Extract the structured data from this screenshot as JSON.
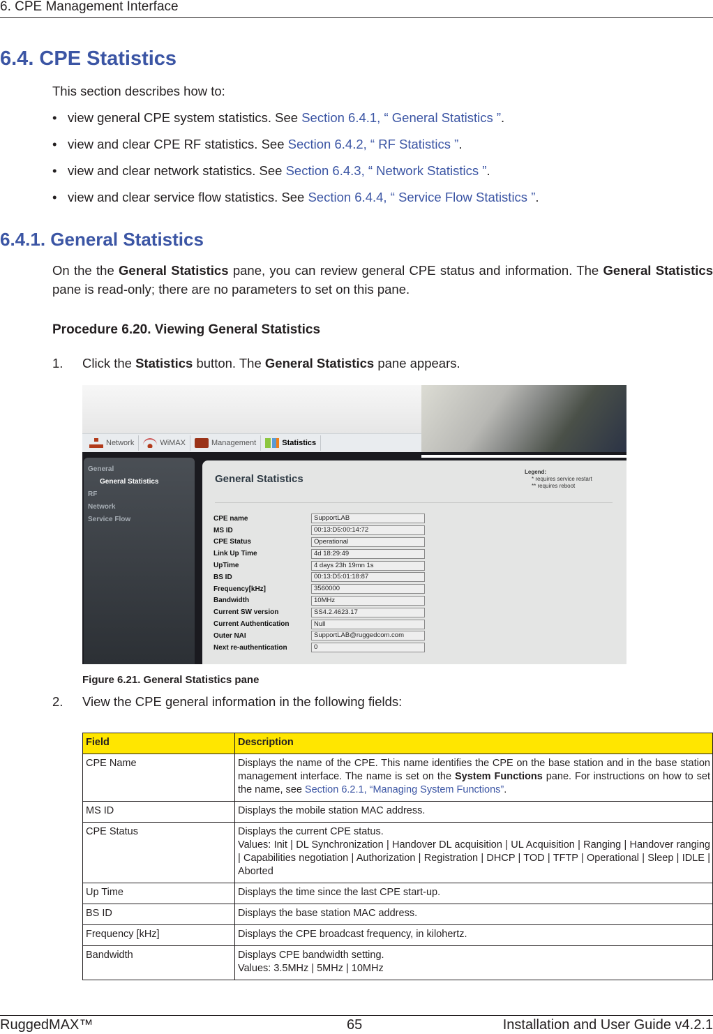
{
  "header": {
    "running_title": "6. CPE Management Interface"
  },
  "section": {
    "title": "6.4. CPE Statistics",
    "intro": "This section describes how to:",
    "bullets": [
      {
        "text": "view general CPE system statistics. See ",
        "link": "Section 6.4.1, “ General Statistics ”",
        "tail": "."
      },
      {
        "text": "view and clear CPE RF statistics. See ",
        "link": "Section 6.4.2, “ RF Statistics ”",
        "tail": "."
      },
      {
        "text": "view and clear network statistics. See ",
        "link": "Section 6.4.3, “ Network Statistics ”",
        "tail": "."
      },
      {
        "text": "view and clear service flow statistics. See ",
        "link": "Section 6.4.4, “ Service Flow Statistics ”",
        "tail": "."
      }
    ]
  },
  "subsection": {
    "title": "6.4.1.  General Statistics",
    "para_1": "On the the ",
    "para_bold_1": "General Statistics",
    "para_2": " pane, you can review general CPE status and information. The ",
    "para_bold_2": "General Statistics",
    "para_3": " pane is read-only; there are no parameters to set on this pane."
  },
  "procedure": {
    "title": "Procedure 6.20. Viewing General Statistics",
    "step1": {
      "num": "1.",
      "t1": "Click the ",
      "b1": "Statistics",
      "t2": " button. The ",
      "b2": "General Statistics",
      "t3": " pane appears."
    },
    "step2": {
      "num": "2.",
      "text": "View the CPE general information in the following fields:"
    }
  },
  "screenshot": {
    "nav": [
      {
        "label": "Network",
        "icon": "network-icon"
      },
      {
        "label": "WiMAX",
        "icon": "wimax-icon"
      },
      {
        "label": "Management",
        "icon": "management-icon"
      },
      {
        "label": "Statistics",
        "icon": "statistics-icon",
        "active": true
      }
    ],
    "sidebar": [
      {
        "label": "General"
      },
      {
        "label": "General Statistics",
        "sub": true
      },
      {
        "label": "RF"
      },
      {
        "label": "Network"
      },
      {
        "label": "Service Flow"
      }
    ],
    "pane_title": "General Statistics",
    "legend": {
      "title": "Legend:",
      "line1": "*  requires service restart",
      "line2": "** requires reboot"
    },
    "fields": [
      {
        "label": "CPE name",
        "value": "SupportLAB"
      },
      {
        "label": "MS ID",
        "value": "00:13:D5:00:14:72"
      },
      {
        "label": "CPE Status",
        "value": "Operational"
      },
      {
        "label": "Link Up Time",
        "value": "4d 18:29:49"
      },
      {
        "label": "UpTime",
        "value": "4 days 23h 19mn 1s"
      },
      {
        "label": "BS ID",
        "value": "00:13:D5:01:18:87"
      },
      {
        "label": "Frequency[kHz]",
        "value": "3560000"
      },
      {
        "label": "Bandwidth",
        "value": "10MHz"
      },
      {
        "label": "Current SW version",
        "value": "SS4.2.4623.17"
      },
      {
        "label": "Current Authentication",
        "value": "Null"
      },
      {
        "label": "Outer NAI",
        "value": "SupportLAB@ruggedcom.com"
      },
      {
        "label": "Next re-authentication",
        "value": "0"
      }
    ]
  },
  "figure_caption": "Figure 6.21. General Statistics pane",
  "table": {
    "headers": [
      "Field",
      "Description"
    ],
    "rows": [
      {
        "field": "CPE Name",
        "d1": "Displays the name of the CPE. This name identifies the CPE on the base station and in the base station management interface. The name is set on the ",
        "bold": "System Functions",
        "d2": " pane. For instructions on how to set the name, see ",
        "link": "Section 6.2.1, “Managing System Functions”",
        "d3": "."
      },
      {
        "field": "MS ID",
        "d1": "Displays the mobile station MAC address."
      },
      {
        "field": "CPE Status",
        "d1": "Displays the current CPE status.",
        "values": "Values: Init | DL Synchronization | Handover DL acquisition | UL Acquisition | Ranging | Handover ranging | Capabilities negotiation | Authorization | Registration | DHCP | TOD | TFTP | Operational | Sleep | IDLE | Aborted"
      },
      {
        "field": "Up Time",
        "d1": "Displays the time since the last CPE start-up."
      },
      {
        "field": "BS ID",
        "d1": "Displays the base station MAC address."
      },
      {
        "field": "Frequency [kHz]",
        "d1": "Displays the CPE broadcast frequency, in kilohertz."
      },
      {
        "field": "Bandwidth",
        "d1": "Displays CPE bandwidth setting.",
        "values": "Values: 3.5MHz | 5MHz | 10MHz"
      }
    ]
  },
  "footer": {
    "left": "RuggedMAX™",
    "page": "65",
    "right": "Installation and User Guide v4.2.1"
  },
  "colors": {
    "heading_blue": "#3b55a4",
    "table_header_yellow": "#ffe600"
  }
}
